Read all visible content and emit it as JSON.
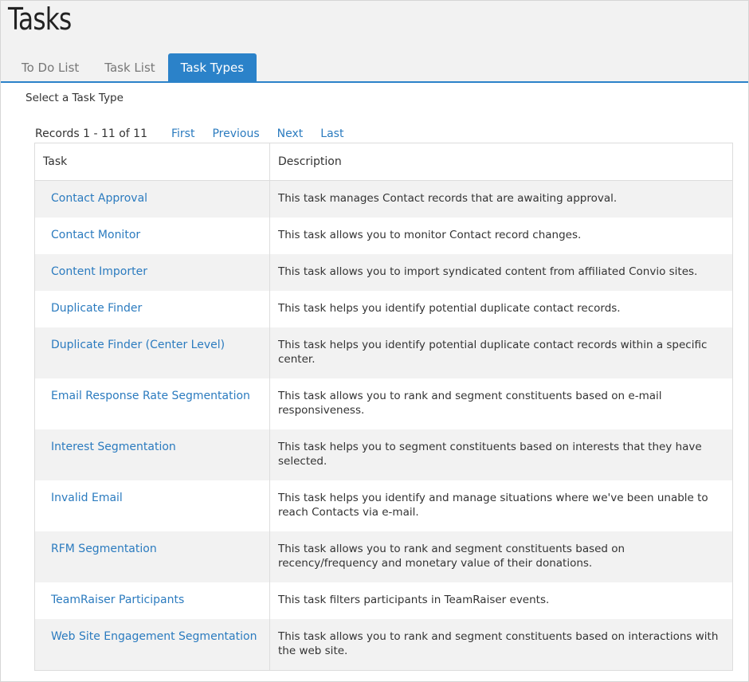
{
  "page": {
    "title": "Tasks"
  },
  "tabs": [
    {
      "label": "To Do List",
      "active": false
    },
    {
      "label": "Task List",
      "active": false
    },
    {
      "label": "Task Types",
      "active": true
    }
  ],
  "main": {
    "subtitle": "Select a Task Type",
    "pager": {
      "records": "Records 1 - 11 of 11",
      "first": "First",
      "previous": "Previous",
      "next": "Next",
      "last": "Last"
    },
    "table": {
      "headers": {
        "task": "Task",
        "description": "Description"
      },
      "rows": [
        {
          "task": "Contact Approval",
          "description": "This task manages Contact records that are awaiting approval."
        },
        {
          "task": "Contact Monitor",
          "description": "This task allows you to monitor Contact record changes."
        },
        {
          "task": "Content Importer",
          "description": "This task allows you to import syndicated content from affiliated Convio sites."
        },
        {
          "task": "Duplicate Finder",
          "description": "This task helps you identify potential duplicate contact records."
        },
        {
          "task": "Duplicate Finder (Center Level)",
          "description": "This task helps you identify potential duplicate contact records within a specific center."
        },
        {
          "task": "Email Response Rate Segmentation",
          "description": "This task allows you to rank and segment constituents based on e-mail responsiveness."
        },
        {
          "task": "Interest Segmentation",
          "description": "This task helps you to segment constituents based on interests that they have selected."
        },
        {
          "task": "Invalid Email",
          "description": "This task helps you identify and manage situations where we've been unable to reach Contacts via e-mail."
        },
        {
          "task": "RFM Segmentation",
          "description": "This task allows you to rank and segment constituents based on recency/frequency and monetary value of their donations."
        },
        {
          "task": "TeamRaiser Participants",
          "description": "This task filters participants in TeamRaiser events."
        },
        {
          "task": "Web Site Engagement Segmentation",
          "description": "This task allows you to rank and segment constituents based on interactions with the web site."
        }
      ]
    }
  },
  "colors": {
    "accent": "#2b82c9",
    "link": "#2b7bbf",
    "stripe": "#f2f2f2"
  }
}
